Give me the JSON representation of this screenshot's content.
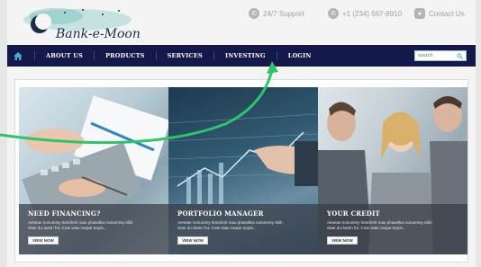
{
  "header": {
    "logo_text": "Bank-e-Moon",
    "contacts": [
      {
        "icon": "phone-icon",
        "label": "24/7 Support"
      },
      {
        "icon": "phone-icon",
        "label": "+1 (234) 567-8910"
      },
      {
        "icon": "chat-icon",
        "label": "Contact Us"
      }
    ]
  },
  "nav": {
    "items": [
      "ABOUT US",
      "PRODUCTS",
      "SERVICES",
      "INVESTING",
      "LOGIN"
    ],
    "search_placeholder": "search"
  },
  "panels": [
    {
      "title": "NEED FINANCING?",
      "text": "Aenean nonummy hendrerit mau phasellus nonummy nibh vitae dui lamin fot. Cras vitae neque turpis...",
      "button": "VIEW NOW"
    },
    {
      "title": "PORTFOLIO MANAGER",
      "text": "Aenean nonummy hendrerit mau phasellus nonummy nibh vitae dui lamin fot. Cras vitae neque turpis...",
      "button": "VIEW NOW"
    },
    {
      "title": "YOUR CREDIT",
      "text": "Aenean nonummy hendrerit mau phasellus nonummy nibh vitae dui lamin fot. Cras vitae neque turpis...",
      "button": "VIEW NOW"
    }
  ],
  "colors": {
    "nav_bg": "#15194a",
    "annotation_arrow": "#2dc46a",
    "accent": "#4aa9c9"
  }
}
